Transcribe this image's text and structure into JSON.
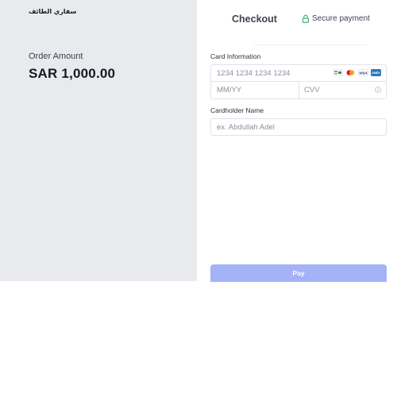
{
  "merchant": {
    "name": "سفاري الطائف"
  },
  "order": {
    "label": "Order Amount",
    "amount": "SAR 1,000.00"
  },
  "header": {
    "title": "Checkout",
    "secure_label": "Secure payment"
  },
  "card": {
    "label": "Card Information",
    "number_placeholder": "1234 1234 1234 1234",
    "expiry_placeholder": "MM/YY",
    "cvv_placeholder": "CVV",
    "logos": [
      "madamir-icon",
      "mastercard-icon",
      "visa-icon",
      "amex-icon"
    ],
    "visa_text": "VISA",
    "amex_text": "AMEX"
  },
  "cardholder": {
    "label": "Cardholder Name",
    "placeholder": "ex. Abdullah Adel"
  },
  "pay": {
    "label": "Pay"
  },
  "colors": {
    "accent": "#a4b2f8",
    "left_bg": "#e9eaee",
    "secure_green": "#2faa6b"
  }
}
